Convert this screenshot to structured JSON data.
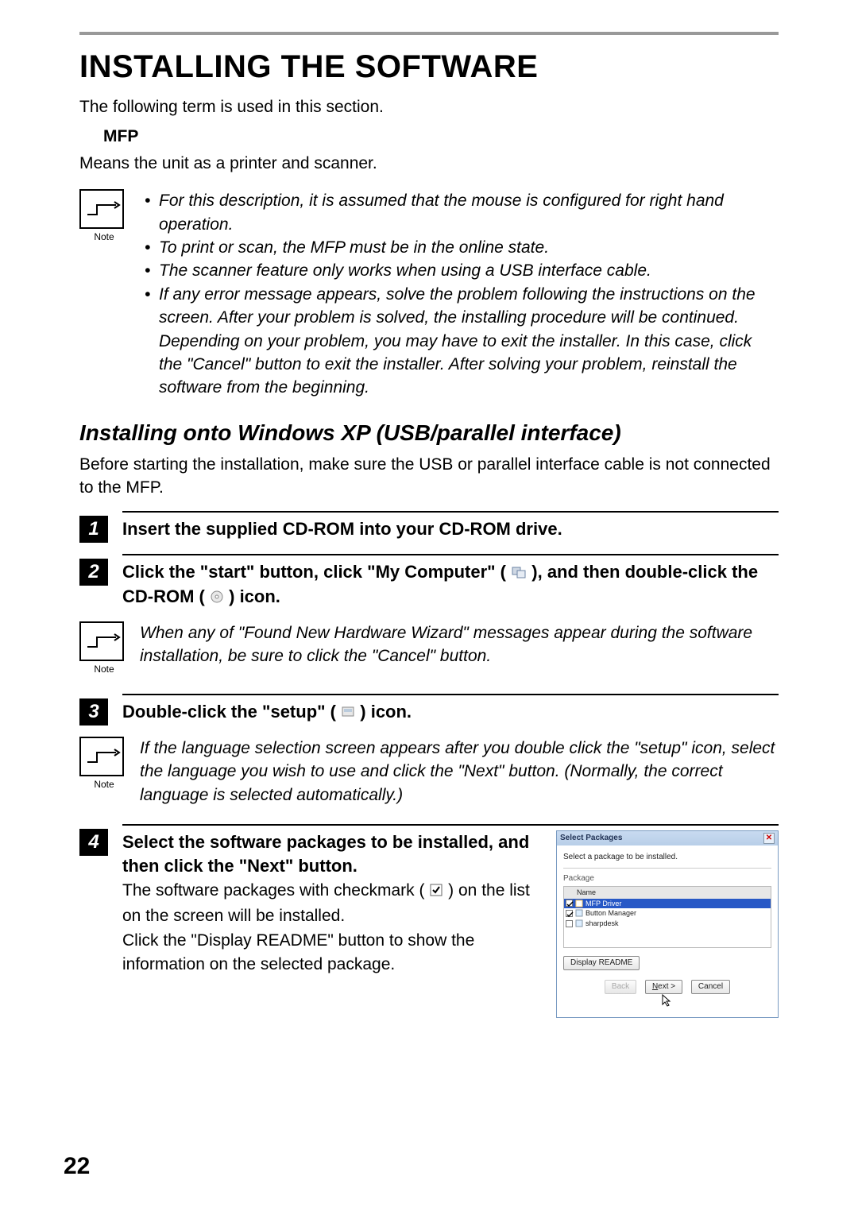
{
  "page_number": "22",
  "title": "INSTALLING THE SOFTWARE",
  "intro": "The following term is used in this section.",
  "term": {
    "label": "MFP",
    "desc": "Means the unit as a printer and scanner."
  },
  "top_note_label": "Note",
  "top_notes": [
    "For this description, it is assumed that the mouse is configured for right hand operation.",
    "To print or scan, the MFP must be in the online state.",
    "The scanner feature only works when using a USB interface cable.",
    "If any error message appears, solve the problem following the instructions on the screen. After your problem is solved, the installing procedure will be continued. Depending on your problem, you may have to exit the installer. In this case, click the \"Cancel\" button to exit the installer. After solving your problem, reinstall the software from the beginning."
  ],
  "section_heading": "Installing onto Windows XP (USB/parallel interface)",
  "section_intro": "Before starting the installation, make sure the USB or parallel interface cable is not connected to the MFP.",
  "steps": {
    "s1": {
      "num": "1",
      "title": "Insert the supplied CD-ROM into your CD-ROM drive."
    },
    "s2": {
      "num": "2",
      "t_a": "Click the \"start\" button, click \"My Computer\" (",
      "t_b": "), and then double-click the CD-ROM (",
      "t_c": ") icon.",
      "note_label": "Note",
      "note": "When any of \"Found New Hardware Wizard\" messages appear during the software installation, be sure to click the \"Cancel\" button."
    },
    "s3": {
      "num": "3",
      "t_a": "Double-click the \"setup\" (",
      "t_b": ") icon.",
      "note_label": "Note",
      "note": "If the language selection screen appears after you double click the \"setup\" icon, select the language you wish to use and click the \"Next\" button. (Normally, the correct language is selected automatically.)"
    },
    "s4": {
      "num": "4",
      "title": "Select the software packages to be installed, and then click the \"Next\" button.",
      "desc1_a": "The software packages with checkmark (",
      "desc1_b": ") on the list on the screen will be installed.",
      "desc2": "Click the \"Display README\" button to show the information on the selected package."
    }
  },
  "dialog": {
    "title": "Select Packages",
    "subtitle": "Select a package to be installed.",
    "package_label": "Package",
    "name_header": "Name",
    "items": {
      "0": {
        "label": "MFP Driver"
      },
      "1": {
        "label": "Button Manager"
      },
      "2": {
        "label": "sharpdesk"
      }
    },
    "readme_btn": "Display README",
    "back_btn": "Back",
    "next_btn_prefix": "N",
    "next_btn_rest": "ext >",
    "cancel_btn": "Cancel",
    "close_glyph": "✕"
  }
}
